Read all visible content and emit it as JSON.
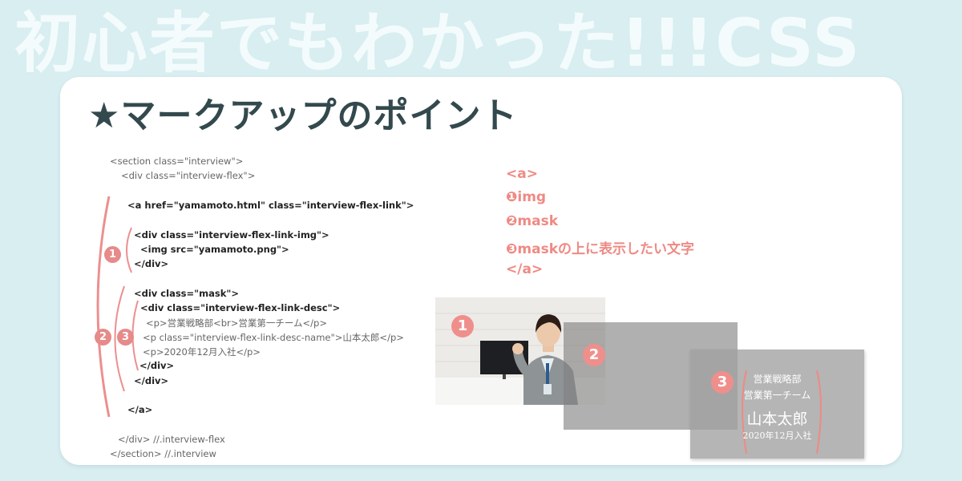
{
  "banner_title": "初心者でもわかった!!!CSS",
  "heading": "★マークアップのポイント",
  "code_lines": [
    "<section class=\"interview\">",
    "<div class=\"interview-flex\">",
    "<a href=\"yamamoto.html\" class=\"interview-flex-link\">",
    "<div class=\"interview-flex-link-img\">",
    "<img src=\"yamamoto.png\">",
    "</div>",
    "<div class=\"mask\">",
    "<div class=\"interview-flex-link-desc\">",
    "<p>営業戦略部<br>営業第一チーム</p>",
    "<p class=\"interview-flex-link-desc-name\">山本太郎</p>",
    "<p>2020年12月入社</p>",
    "</div>",
    "</div>",
    "</a>",
    "</div> //.interview-flex",
    "</section> //.interview"
  ],
  "markers": {
    "one": "1",
    "two": "2",
    "three": "3"
  },
  "legend": [
    "<a>",
    "❶img",
    "❷mask",
    "❸maskの上に表示したい文字",
    "</a>"
  ],
  "profile": {
    "dept": "営業戦略部",
    "team": "営業第一チーム",
    "name": "山本太郎",
    "joined": "2020年12月入社"
  },
  "colors": {
    "accent": "#ee8a84",
    "background": "#d8eef1",
    "heading": "#33494d"
  }
}
